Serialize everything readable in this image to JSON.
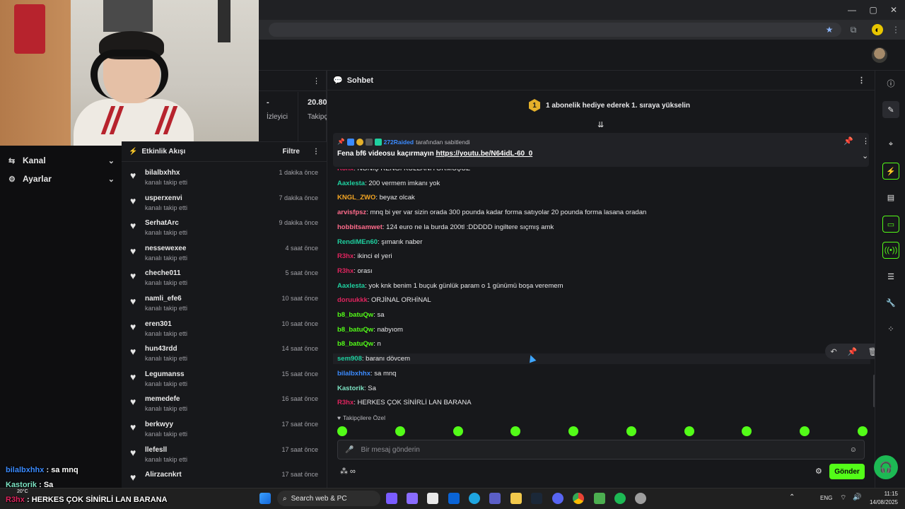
{
  "browser": {
    "window_controls": [
      "—",
      "▢",
      "✕"
    ],
    "toolbar_icons": [
      "star-icon",
      "extensions-icon",
      "profile-icon",
      "menu-icon"
    ]
  },
  "nav": {
    "items": [
      {
        "label": "Kanal",
        "icon": "broadcast-icon"
      },
      {
        "label": "Ayarlar",
        "icon": "gear-icon"
      }
    ]
  },
  "stats": {
    "viewers_value": "-",
    "viewers_label": "İzleyici",
    "followers_value": "20.80",
    "followers_label": "Takipç"
  },
  "activity": {
    "title": "Etkinlik Akışı",
    "filter_label": "Filtre",
    "items": [
      {
        "user": "bilalbxhhx",
        "action": "kanalı takip etti",
        "time": "1 dakika önce"
      },
      {
        "user": "usperxenvi",
        "action": "kanalı takip etti",
        "time": "7 dakika önce"
      },
      {
        "user": "SerhatArc",
        "action": "kanalı takip etti",
        "time": "9 dakika önce"
      },
      {
        "user": "nessewexee",
        "action": "kanalı takip etti",
        "time": "4 saat önce"
      },
      {
        "user": "cheche011",
        "action": "kanalı takip etti",
        "time": "5 saat önce"
      },
      {
        "user": "namli_efe6",
        "action": "kanalı takip etti",
        "time": "10 saat önce"
      },
      {
        "user": "eren301",
        "action": "kanalı takip etti",
        "time": "10 saat önce"
      },
      {
        "user": "hun43rdd",
        "action": "kanalı takip etti",
        "time": "14 saat önce"
      },
      {
        "user": "Legumanss",
        "action": "kanalı takip etti",
        "time": "15 saat önce"
      },
      {
        "user": "memedefe",
        "action": "kanalı takip etti",
        "time": "16 saat önce"
      },
      {
        "user": "berkwyy",
        "action": "kanalı takip etti",
        "time": "17 saat önce"
      },
      {
        "user": "llefesll",
        "action": "kanalı takip etti",
        "time": "17 saat önce"
      },
      {
        "user": "Alirzacnkrt",
        "action": "",
        "time": "17 saat önce"
      }
    ]
  },
  "chat": {
    "title": "Sohbet",
    "gift_rank": "1",
    "gift_banner": "1 abonelik hediye ederek 1. sıraya yükselin",
    "pinned": {
      "by_user": "272Raided",
      "by_suffix": "tarafından sabitlendi",
      "text": "Fena bf6 videosu kaçırmayın",
      "link": "https://youtu.be/N64idL-60_0"
    },
    "messages": [
      {
        "user": "R3hx",
        "text": "NONIŞ RENGI KULLANIYORMUŞUZ",
        "color": "#e0245e"
      },
      {
        "user": "Aaxlesta",
        "text": "200 vermem imkanı yok",
        "color": "#1fd1a0"
      },
      {
        "user": "KNGL_ZWO",
        "text": "beyaz olcak",
        "color": "#f5a623"
      },
      {
        "user": "arvisfpsz",
        "text": "mnq bi yer var sizin orada 300 pounda kadar forma satıyolar 20 pounda forma lasana oradan",
        "color": "#ff6b8b"
      },
      {
        "user": "hobbitsamwet",
        "text": "124 euro ne la burda 200tl :DDDDD ingiltere sıçmış amk",
        "color": "#ff6b8b"
      },
      {
        "user": "RendiMEn60",
        "text": "şımarık naber",
        "color": "#1fd1a0"
      },
      {
        "user": "R3hx",
        "text": "ikinci el yeri",
        "color": "#e0245e"
      },
      {
        "user": "R3hx",
        "text": "orası",
        "color": "#e0245e"
      },
      {
        "user": "Aaxlesta",
        "text": "yok knk benim 1 buçuk günlük param o 1 günümü boşa veremem",
        "color": "#1fd1a0"
      },
      {
        "user": "doruukkk",
        "text": "ORJİNAL ORHİNAL",
        "color": "#e0245e"
      },
      {
        "user": "b8_batuQw",
        "text": "sa",
        "color": "#53fc18"
      },
      {
        "user": "b8_batuQw",
        "text": "nabyıom",
        "color": "#53fc18"
      },
      {
        "user": "b8_batuQw",
        "text": "n",
        "color": "#53fc18"
      },
      {
        "user": "sem908",
        "text": "baranı dövcem",
        "color": "#1fd1a0"
      },
      {
        "user": "bilalbxhhx",
        "text": "sa mnq",
        "color": "#3b8bff"
      },
      {
        "user": "Kastorik",
        "text": "Sa",
        "color": "#7de3c3"
      },
      {
        "user": "R3hx",
        "text": "HERKES ÇOK SİNİRLİ LAN BARANA",
        "color": "#e0245e"
      }
    ],
    "emote_section_label": "Takipçilere Özel",
    "input_placeholder": "Bir mesaj gönderin",
    "send_label": "Gönder",
    "accent": "#53fc18"
  },
  "overlay": {
    "lines": [
      {
        "user": "bilalbxhhx",
        "text": "sa mnq",
        "color": "#3b8bff"
      },
      {
        "user": "Kastorik",
        "text": "Sa",
        "color": "#7de3c3"
      },
      {
        "user": "R3hx",
        "text": "HERKES ÇOK SİNİRLİ LAN BARANA",
        "color": "#e0245e"
      }
    ]
  },
  "taskbar": {
    "search_label": "Search web & PC",
    "weather": "20°C",
    "lang": "ENG",
    "time": "11:15",
    "date": "14/08/2025"
  }
}
